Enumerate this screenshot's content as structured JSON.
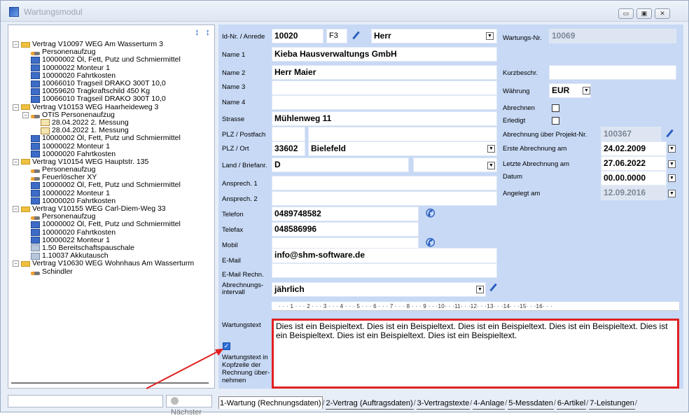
{
  "window": {
    "title": "Wartungsmodul",
    "controls": [
      "▭",
      "▣",
      "✕"
    ]
  },
  "tree": {
    "toolbar": [
      "↕",
      "↕"
    ],
    "nodes": [
      {
        "level": 0,
        "exp": "−",
        "icon": "folder",
        "label": "Vertrag V10097 WEG Am Wasserturm 3"
      },
      {
        "level": 1,
        "icon": "elev",
        "label": "Personenaufzug"
      },
      {
        "level": 1,
        "icon": "box",
        "label": "10000002 Öl, Fett, Putz und Schmiermittel"
      },
      {
        "level": 1,
        "icon": "box",
        "label": "10000022 Monteur 1"
      },
      {
        "level": 1,
        "icon": "box",
        "label": "10000020 Fahrtkosten"
      },
      {
        "level": 1,
        "icon": "box",
        "label": "10066010 Tragseil DRAKO 300T 10,0"
      },
      {
        "level": 1,
        "icon": "box",
        "label": "10059620 Tragkraftschild 450 Kg"
      },
      {
        "level": 1,
        "icon": "box",
        "label": "10066010 Tragseil DRAKO 300T 10,0"
      },
      {
        "level": 0,
        "exp": "−",
        "icon": "folder",
        "label": "Vertrag V10153 WEG Haarheideweg 3"
      },
      {
        "level": 1,
        "exp": "−",
        "icon": "elev",
        "label": "OTIS Personenaufzug"
      },
      {
        "level": 2,
        "icon": "doc",
        "label": "28.04.2022 2. Messung"
      },
      {
        "level": 2,
        "icon": "doc",
        "label": "28.04.2022 1. Messung"
      },
      {
        "level": 1,
        "icon": "box",
        "label": "10000002 Öl, Fett, Putz und Schmiermittel"
      },
      {
        "level": 1,
        "icon": "box",
        "label": "10000022 Monteur 1"
      },
      {
        "level": 1,
        "icon": "box",
        "label": "10000020 Fahrtkosten"
      },
      {
        "level": 0,
        "exp": "−",
        "icon": "folder",
        "label": "Vertrag V10154 WEG Hauptstr. 135"
      },
      {
        "level": 1,
        "icon": "elev",
        "label": "Personenaufzug"
      },
      {
        "level": 1,
        "icon": "elev",
        "label": "Feuerlöscher XY"
      },
      {
        "level": 1,
        "icon": "box",
        "label": "10000002 Öl, Fett, Putz und Schmiermittel"
      },
      {
        "level": 1,
        "icon": "box",
        "label": "10000022 Monteur 1"
      },
      {
        "level": 1,
        "icon": "box",
        "label": "10000020 Fahrtkosten"
      },
      {
        "level": 0,
        "exp": "−",
        "icon": "folder",
        "label": "Vertrag V10155 WEG Carl-Diem-Weg 33"
      },
      {
        "level": 1,
        "icon": "elev",
        "label": "Personenaufzug"
      },
      {
        "level": 1,
        "icon": "box",
        "label": "10000002 Öl, Fett, Putz und Schmiermittel"
      },
      {
        "level": 1,
        "icon": "box",
        "label": "10000020 Fahrtkosten"
      },
      {
        "level": 1,
        "icon": "box",
        "label": "10000022 Monteur 1"
      },
      {
        "level": 1,
        "icon": "pay",
        "label": "1.50 Bereitschaftspauschale"
      },
      {
        "level": 1,
        "icon": "pay",
        "label": "1.10037 Akkutausch"
      },
      {
        "level": 0,
        "exp": "−",
        "icon": "folder",
        "label": "Vertrag V10630 WEG Wohnhaus Am Wasserturm"
      },
      {
        "level": 1,
        "icon": "elev",
        "label": "Schindler"
      }
    ]
  },
  "search": {
    "value": "",
    "next_label": "Nächster"
  },
  "form": {
    "labels": {
      "id_anrede": "Id-Nr. / Anrede",
      "name1": "Name 1",
      "name2": "Name 2",
      "name3": "Name 3",
      "name4": "Name 4",
      "strasse": "Strasse",
      "plz_postfach": "PLZ / Postfach",
      "plz_ort": "PLZ / Ort",
      "land": "Land / Briefanr.",
      "ansprech1": "Ansprech. 1",
      "ansprech2": "Ansprech. 2",
      "telefon": "Telefon",
      "telefax": "Telefax",
      "mobil": "Mobil",
      "email": "E-Mail",
      "email_rechn": "E-Mail Rechn.",
      "abrechnungsintervall_1": "Abrechnungs-",
      "abrechnungsintervall_2": "intervall",
      "wartungstext": "Wartungstext",
      "kopfzeile_1": "Wartungstext in",
      "kopfzeile_2": "Kopfzeile der",
      "kopfzeile_3": "Rechnung über-",
      "kopfzeile_4": "nehmen",
      "wartungs_nr": "Wartungs-Nr.",
      "kurzbeschr": "Kurzbeschr.",
      "waehrung": "Währung",
      "abrechnen": "Abrechnen",
      "erledigt": "Erledigt",
      "abrechnung_projekt": "Abrechnung über Projekt-Nr.",
      "erste_abrechnung": "Erste Abrechnung am",
      "letzte_abrechnung": "Letzte Abrechnung am",
      "datum": "Datum",
      "angelegt": "Angelegt am"
    },
    "values": {
      "id": "10020",
      "f3": "F3",
      "anrede": "Herr",
      "name1": "Kieba Hausverwaltungs GmbH",
      "name2": "Herr Maier",
      "name3": "",
      "name4": "",
      "strasse": "Mühlenweg 11",
      "plz_postfach": "",
      "postfach": "",
      "plz": "33602",
      "ort": "Bielefeld",
      "land": "D",
      "briefanr": "",
      "ansprech1": "",
      "ansprech2": "",
      "telefon": "0489748582",
      "telefax": "048586996",
      "mobil": "",
      "email": "info@shm-software.de",
      "email_rechn": "",
      "abrechnungsintervall": "jährlich",
      "wartungs_nr": "10069",
      "kurzbeschr": "",
      "waehrung": "EUR",
      "projekt_nr": "100367",
      "erste_abrechnung": "24.02.2009",
      "letzte_abrechnung": "27.06.2022",
      "datum": "00.00.0000",
      "angelegt": "12.09.2016",
      "wartungstext": "Dies ist ein Beispieltext. Dies ist ein Beispieltext. Dies ist ein Beispieltext. Dies ist ein Beispieltext. Dies ist ein Beispieltext. Dies ist ein Beispieltext. Dies ist ein Beispieltext."
    },
    "ruler": "· · · 1 · · · 2 · · · 3 · · · 4 · · · 5 · · · 6 · · · 7 · · · 8 · · · 9 · · ·10· · ·11· · ·12· · ·13· · ·14· · ·15· · ·16· · ·"
  },
  "tabs": [
    {
      "label": "1-Wartung (Rechnungsdaten)",
      "active": true
    },
    {
      "label": "2-Vertrag (Auftragsdaten)",
      "active": false
    },
    {
      "label": "3-Vertragstexte",
      "active": false
    },
    {
      "label": "4-Anlage",
      "active": false
    },
    {
      "label": "5-Messdaten",
      "active": false
    },
    {
      "label": "6-Artikel",
      "active": false
    },
    {
      "label": "7-Leistungen",
      "active": false
    }
  ],
  "colors": {
    "accent": "#2b5fbf",
    "highlight": "#e02020",
    "form_bg": "#c7d9f5"
  }
}
